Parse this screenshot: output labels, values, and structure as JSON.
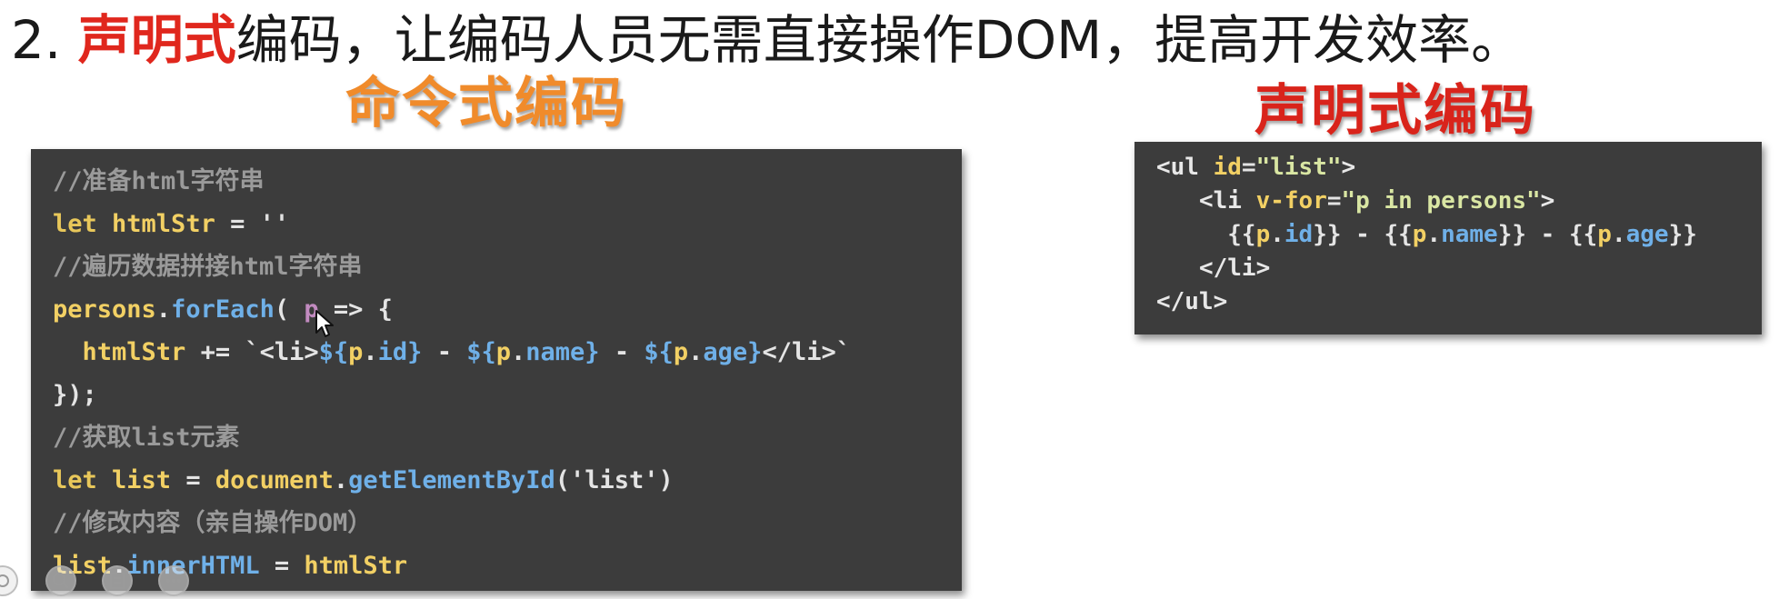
{
  "heading": {
    "prefix": "2. ",
    "accent": "声明式",
    "rest": "编码，让编码人员无需直接操作DOM，提高开发效率。"
  },
  "labels": {
    "imperative": "命令式编码",
    "declarative": "声明式编码"
  },
  "imperative_code": [
    [
      {
        "t": "//准备html字符串",
        "c": "comment"
      }
    ],
    [
      {
        "t": "let",
        "c": "keyword"
      },
      {
        "t": " htmlStr ",
        "c": "ident"
      },
      {
        "t": "= ",
        "c": "plain"
      },
      {
        "t": "''",
        "c": "string"
      }
    ],
    [
      {
        "t": "//遍历数据拼接html字符串",
        "c": "comment"
      }
    ],
    [
      {
        "t": "persons",
        "c": "ident"
      },
      {
        "t": ".",
        "c": "plain"
      },
      {
        "t": "forEach",
        "c": "method"
      },
      {
        "t": "( ",
        "c": "plain"
      },
      {
        "t": "p",
        "c": "param"
      },
      {
        "t": " => {",
        "c": "plain"
      }
    ],
    [
      {
        "t": "  htmlStr ",
        "c": "ident"
      },
      {
        "t": "+= `<li>",
        "c": "plain"
      },
      {
        "t": "${",
        "c": "interp"
      },
      {
        "t": "p",
        "c": "var"
      },
      {
        "t": ".",
        "c": "plain"
      },
      {
        "t": "id",
        "c": "interp"
      },
      {
        "t": "}",
        "c": "interp"
      },
      {
        "t": " - ",
        "c": "plain"
      },
      {
        "t": "${",
        "c": "interp"
      },
      {
        "t": "p",
        "c": "var"
      },
      {
        "t": ".",
        "c": "plain"
      },
      {
        "t": "name",
        "c": "interp"
      },
      {
        "t": "}",
        "c": "interp"
      },
      {
        "t": " - ",
        "c": "plain"
      },
      {
        "t": "${",
        "c": "interp"
      },
      {
        "t": "p",
        "c": "var"
      },
      {
        "t": ".",
        "c": "plain"
      },
      {
        "t": "age",
        "c": "interp"
      },
      {
        "t": "}",
        "c": "interp"
      },
      {
        "t": "</li>`",
        "c": "plain"
      }
    ],
    [
      {
        "t": "});",
        "c": "plain"
      }
    ],
    [
      {
        "t": "//获取list元素",
        "c": "comment"
      }
    ],
    [
      {
        "t": "let",
        "c": "keyword"
      },
      {
        "t": " list ",
        "c": "ident"
      },
      {
        "t": "= ",
        "c": "plain"
      },
      {
        "t": "document",
        "c": "ident"
      },
      {
        "t": ".",
        "c": "plain"
      },
      {
        "t": "getElementById",
        "c": "method"
      },
      {
        "t": "('list')",
        "c": "plain"
      }
    ],
    [
      {
        "t": "//修改内容（亲自操作DOM）",
        "c": "comment"
      }
    ],
    [
      {
        "t": "list",
        "c": "ident"
      },
      {
        "t": ".",
        "c": "plain"
      },
      {
        "t": "innerHTML",
        "c": "method"
      },
      {
        "t": " = ",
        "c": "plain"
      },
      {
        "t": "htmlStr",
        "c": "ident"
      }
    ]
  ],
  "declarative_code": [
    [
      {
        "t": "<ul ",
        "c": "tag"
      },
      {
        "t": "id",
        "c": "attr"
      },
      {
        "t": "=",
        "c": "plain"
      },
      {
        "t": "\"list\"",
        "c": "attrval"
      },
      {
        "t": ">",
        "c": "tag"
      }
    ],
    [
      {
        "t": "   <li ",
        "c": "tag"
      },
      {
        "t": "v-for",
        "c": "attr"
      },
      {
        "t": "=",
        "c": "plain"
      },
      {
        "t": "\"p in persons\"",
        "c": "attrval"
      },
      {
        "t": ">",
        "c": "tag"
      }
    ],
    [
      {
        "t": "     {{",
        "c": "plain"
      },
      {
        "t": "p",
        "c": "var"
      },
      {
        "t": ".",
        "c": "plain"
      },
      {
        "t": "id",
        "c": "interp"
      },
      {
        "t": "}} - {{",
        "c": "plain"
      },
      {
        "t": "p",
        "c": "var"
      },
      {
        "t": ".",
        "c": "plain"
      },
      {
        "t": "name",
        "c": "interp"
      },
      {
        "t": "}} - {{",
        "c": "plain"
      },
      {
        "t": "p",
        "c": "var"
      },
      {
        "t": ".",
        "c": "plain"
      },
      {
        "t": "age",
        "c": "interp"
      },
      {
        "t": "}}",
        "c": "plain"
      }
    ],
    [
      {
        "t": "   </li>",
        "c": "tag"
      }
    ],
    [
      {
        "t": "</ul>",
        "c": "tag"
      }
    ]
  ],
  "icons": {
    "cursor": "mouse-pointer-icon",
    "controls": [
      "grid-icon",
      "search-icon",
      "doc-icon",
      "more-icon"
    ]
  },
  "colors": {
    "accent_red": "#e0271d",
    "accent_orange": "#f08b2b",
    "code_bg": "#3c3c3c"
  }
}
